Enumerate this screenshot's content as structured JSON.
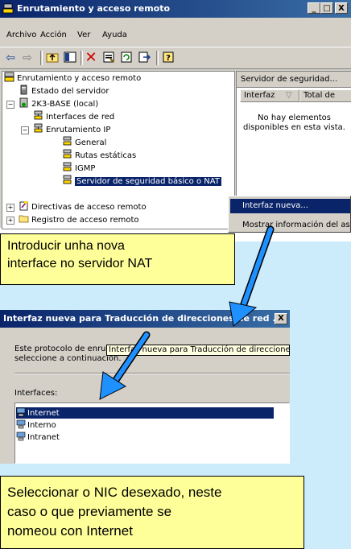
{
  "window": {
    "title": "Enrutamiento y acceso remoto",
    "buttons": [
      "_",
      "□",
      "X"
    ]
  },
  "menu": [
    "Archivo",
    "Acción",
    "Ver",
    "Ayuda"
  ],
  "toolbar_icons": [
    "back-icon",
    "forward-icon",
    "up-folder-icon",
    "show-hide-tree-icon",
    "delete-icon",
    "properties-icon",
    "refresh-icon",
    "export-icon",
    "help-icon"
  ],
  "tree": {
    "root": "Enrutamiento y acceso remoto",
    "server_status": "Estado del servidor",
    "server": "2K3-BASE (local)",
    "net_interfaces": "Interfaces de red",
    "ip_routing": "Enrutamiento IP",
    "general": "General",
    "static_routes": "Rutas estáticas",
    "igmp": "IGMP",
    "nat": "Servidor de seguridad básico o NAT",
    "policies": "Directivas de acceso remoto",
    "logging": "Registro de acceso remoto"
  },
  "right_pane": {
    "header": "Servidor de seguridad...",
    "col1": "Interfaz",
    "col2": "Total de",
    "empty_line1": "No hay elementos",
    "empty_line2": "disponibles en esta vista."
  },
  "context_menu": {
    "item1": "Interfaz nueva...",
    "item2": "Mostrar información del as"
  },
  "callout1": {
    "line1": "Introducir unha nova",
    "line2": "interface no servidor NAT"
  },
  "dialog": {
    "title": "Interfaz nueva para Traducción de direcciones de red ...",
    "close": "X",
    "text_line1": "Este protocolo de enru",
    "text_line2": "seleccione a continuación.",
    "tooltip": "Interfaz nueva para Traducción de direcciones",
    "interfaces_label": "Interfaces:",
    "items": [
      "Internet",
      "Interno",
      "Intranet"
    ]
  },
  "callout2": {
    "line1": "Seleccionar o NIC desexado, neste",
    "line2": "caso o que previamente se",
    "line3": "nomeou con Internet"
  },
  "colors": {
    "title_dark": "#0a246a",
    "title_light": "#3a6ea5",
    "callout": "#ffff99",
    "arrow": "#1e90ff",
    "background": "#ccecfb"
  }
}
